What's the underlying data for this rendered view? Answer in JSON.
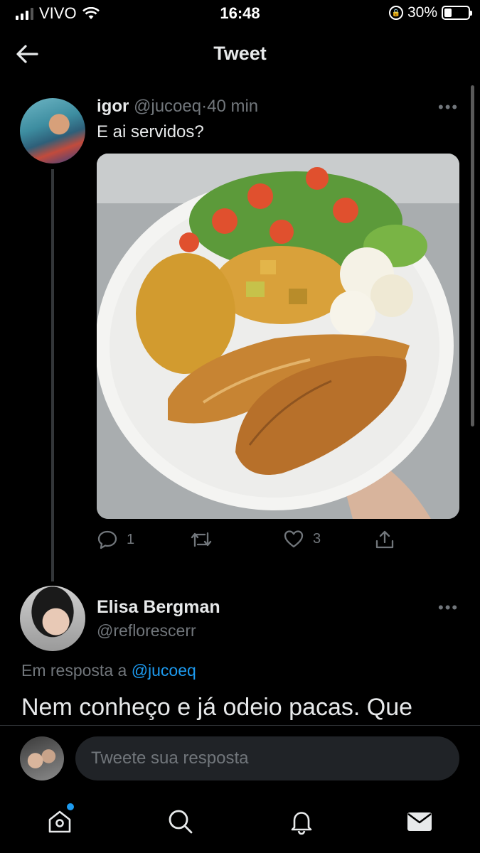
{
  "status_bar": {
    "carrier": "VIVO",
    "time": "16:48",
    "battery": "30%",
    "battery_level": 0.3
  },
  "header": {
    "title": "Tweet"
  },
  "tweet": {
    "author_name": "igor",
    "handle": "@jucoeq",
    "separator": "·",
    "time_ago": "40 min",
    "text": "E ai servidos?",
    "photo_icon": "food-plate-photo",
    "reply_count": "1",
    "like_count": "3"
  },
  "reply": {
    "author_name": "Elisa Bergman",
    "handle": "@reflorescerr",
    "in_reply_prefix": "Em resposta a",
    "in_reply_handle": "@jucoeq",
    "text": "Nem conheço e já odeio pacas. Que"
  },
  "composer": {
    "placeholder": "Tweete sua resposta"
  },
  "colors": {
    "accent": "#1d9bf0",
    "muted": "#71767b",
    "text": "#e7e9ea",
    "background": "#000000"
  },
  "tabs": [
    {
      "icon": "home-icon",
      "has_dot": true
    },
    {
      "icon": "search-icon"
    },
    {
      "icon": "bell-icon"
    },
    {
      "icon": "mail-icon"
    }
  ]
}
